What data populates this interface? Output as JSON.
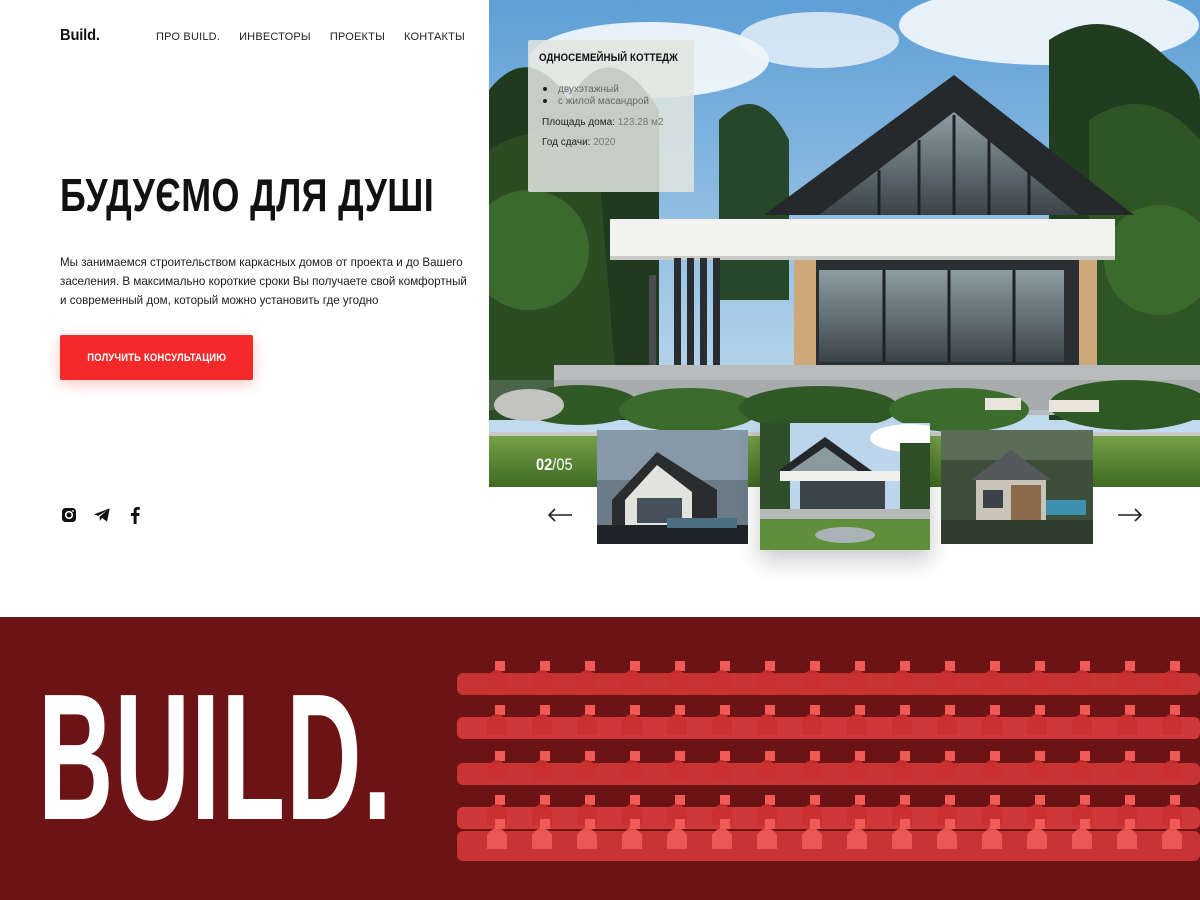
{
  "header": {
    "logo": "Build.",
    "nav": [
      "ПРО BUILD.",
      "ИНВЕСТОРЫ",
      "ПРОЕКТЫ",
      "КОНТАКТЫ"
    ]
  },
  "hero": {
    "title": "БУДУЄМО ДЛЯ ДУШІ",
    "text": "Мы занимаемся строительством каркасных домов от проекта и до Вашего заселения. В максимально короткие сроки Вы получаете свой комфортный и современный дом, который можно установить где угодно",
    "cta": "ПОЛУЧИТЬ КОНСУЛЬТАЦИЮ"
  },
  "socials": [
    "instagram-icon",
    "telegram-icon",
    "facebook-icon"
  ],
  "project_card": {
    "title": "ОДНОСЕМЕЙНЫЙ КОТТЕДЖ",
    "features": [
      "двухэтажный",
      "с жилой масандрой"
    ],
    "area_label": "Площадь дома:",
    "area_value": "123.28 м2",
    "year_label": "Год сдачи:",
    "year_value": "2020"
  },
  "slider": {
    "current": "02",
    "total": "/05"
  },
  "footer_band": {
    "word": "BUILD.",
    "background": "#6c1315"
  },
  "colors": {
    "accent": "#f42a2a",
    "dark": "#111111",
    "band": "#6c1315"
  }
}
